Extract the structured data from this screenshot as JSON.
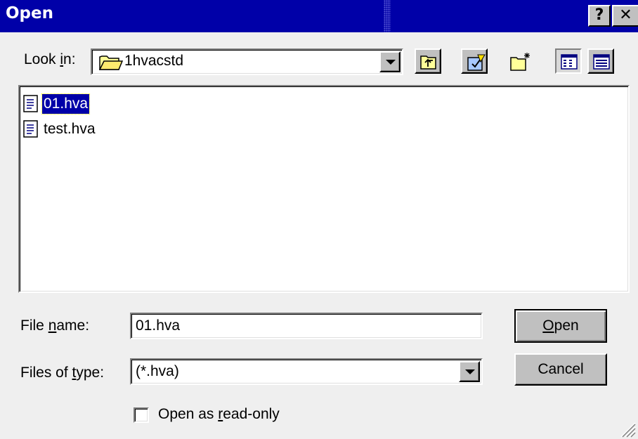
{
  "window": {
    "title": "Open",
    "help_button": "?",
    "close_button": "✕"
  },
  "look_in": {
    "label_before": "Look ",
    "label_mnemonic": "i",
    "label_after": "n:",
    "value": "1hvacstd",
    "icon": "folder-icon"
  },
  "toolbar": [
    {
      "name": "up-one-level-button",
      "icon": "folder-up-icon"
    },
    {
      "name": "look-in-favorites-button",
      "icon": "favorites-icon"
    },
    {
      "name": "create-new-folder-button",
      "icon": "new-folder-icon"
    },
    {
      "name": "list-view-button",
      "icon": "list-view-icon"
    },
    {
      "name": "details-view-button",
      "icon": "details-view-icon"
    }
  ],
  "files": [
    {
      "name": "01.hva",
      "selected": true,
      "icon": "document-icon"
    },
    {
      "name": "test.hva",
      "selected": false,
      "icon": "document-icon"
    }
  ],
  "file_name": {
    "label_before": "File ",
    "label_mnemonic": "n",
    "label_after": "ame:",
    "value": "01.hva"
  },
  "file_type": {
    "label_before": "Files of ",
    "label_mnemonic": "t",
    "label_after": "ype:",
    "value": "(*.hva)"
  },
  "read_only": {
    "label_before": "Open as ",
    "label_mnemonic": "r",
    "label_after": "ead-only",
    "checked": false
  },
  "buttons": {
    "open_mnemonic": "O",
    "open_rest": "pen",
    "cancel": "Cancel"
  },
  "colors": {
    "titlebar": "#0000a8",
    "dialog_face": "#efefef",
    "selection": "#0000a8"
  }
}
